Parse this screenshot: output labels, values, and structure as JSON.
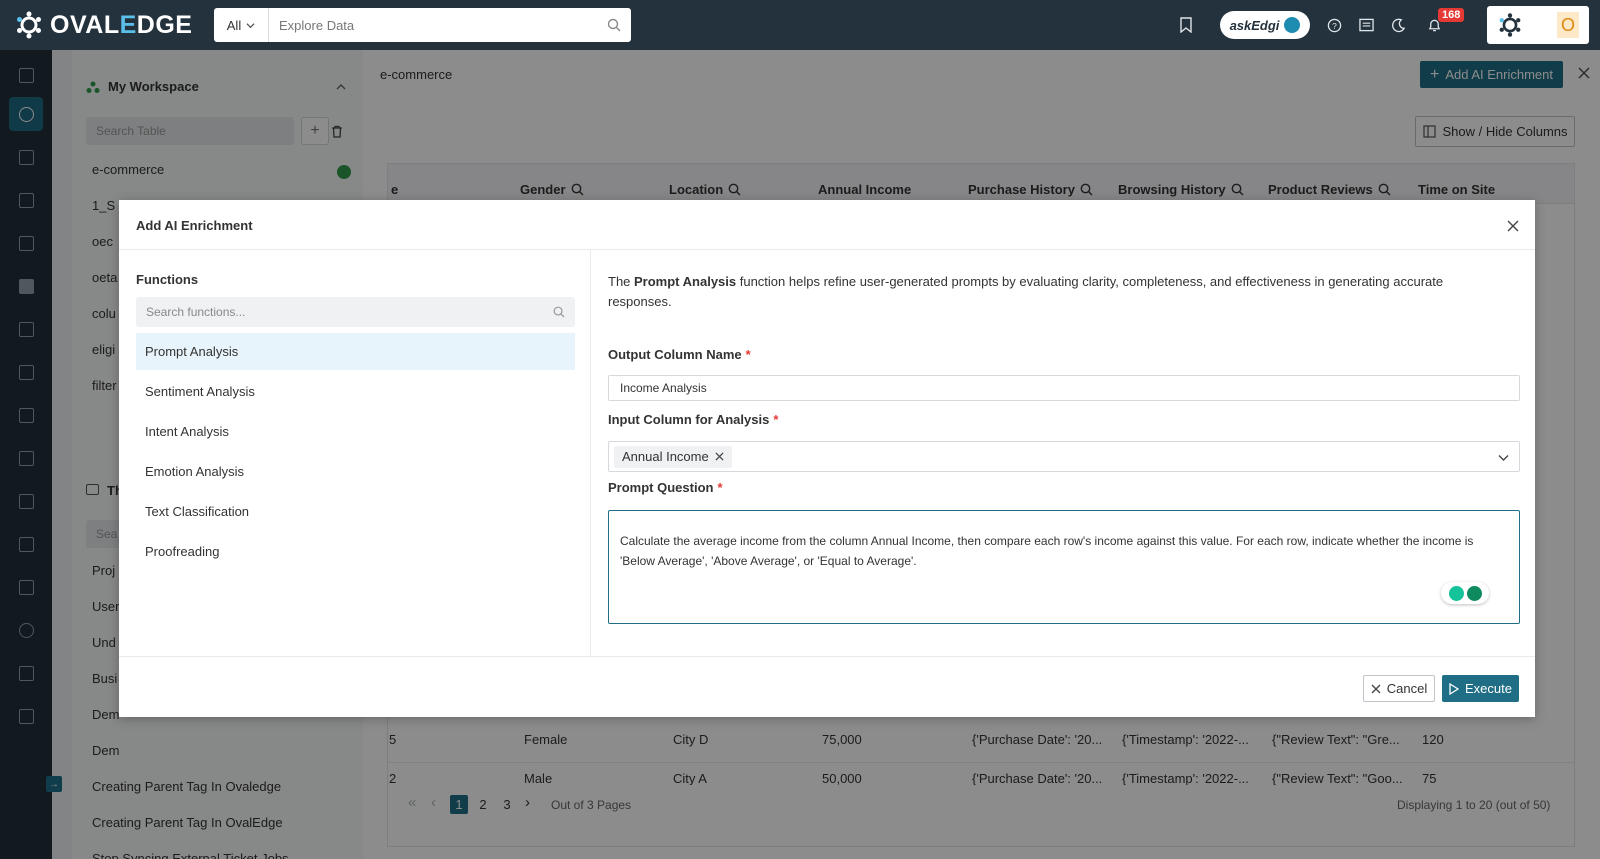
{
  "app": {
    "logo_prefix": "OVAL",
    "logo_highlight": "E",
    "logo_suffix": "DGE"
  },
  "topbar": {
    "search_scope": "All",
    "search_placeholder": "Explore Data",
    "askedgi_label": "askEdgi",
    "notification_count": "168",
    "user_initial": "O"
  },
  "workspace": {
    "title": "My Workspace",
    "search_placeholder": "Search Table",
    "items": [
      "e-commerce",
      "1_S",
      "oec",
      "oeta",
      "colu",
      "eligi",
      "filter"
    ],
    "section_title": "Th",
    "search2_placeholder": "Sea",
    "items2": [
      "Proj",
      "User",
      "Und",
      "Busi",
      "Dem",
      "Dem",
      "Creating Parent Tag In Ovaledge",
      "Creating Parent Tag In OvalEdge",
      "Stop Syncing External Ticket Jobs"
    ]
  },
  "main": {
    "title": "e-commerce",
    "add_enrichment_label": "Add AI Enrichment",
    "show_hide_label": "Show / Hide Columns",
    "columns": [
      "e",
      "Gender",
      "Location",
      "Annual Income",
      "Purchase History",
      "Browsing History",
      "Product Reviews",
      "Time on Site"
    ],
    "rows": [
      {
        "c0": "5",
        "gender": "Female",
        "location": "City D",
        "income": "75,000",
        "purchase": "{'Purchase Date': '20...",
        "browsing": "{'Timestamp': '2022-...",
        "reviews": "{\"Review Text\": \"Gre...",
        "time": "120"
      },
      {
        "c0": "2",
        "gender": "Male",
        "location": "City A",
        "income": "50,000",
        "purchase": "{'Purchase Date': '20...",
        "browsing": "{'Timestamp': '2022-...",
        "reviews": "{\"Review Text\": \"Goo...",
        "time": "75"
      }
    ],
    "pager": {
      "pages": [
        "1",
        "2",
        "3"
      ],
      "out_of": "Out of 3 Pages",
      "displaying": "Displaying 1 to 20 (out of 50)"
    }
  },
  "modal": {
    "title": "Add AI Enrichment",
    "functions_label": "Functions",
    "functions_search_placeholder": "Search functions...",
    "functions": [
      "Prompt Analysis",
      "Sentiment Analysis",
      "Intent Analysis",
      "Emotion Analysis",
      "Text Classification",
      "Proofreading"
    ],
    "selected_function": "Prompt Analysis",
    "description_prefix": "The ",
    "description_bold": "Prompt Analysis",
    "description_suffix": " function helps refine user-generated prompts by evaluating clarity, completeness, and effectiveness in generating accurate responses.",
    "output_label": "Output Column Name",
    "output_value": "Income Analysis",
    "input_label": "Input Column for Analysis",
    "input_chip": "Annual Income",
    "prompt_label": "Prompt Question",
    "prompt_value": "Calculate the average income from the column Annual Income, then compare each row's income against this value. For each row, indicate whether the income is 'Below Average', 'Above Average', or 'Equal to Average'.",
    "required_mark": "*",
    "cancel_label": "Cancel",
    "execute_label": "Execute"
  },
  "colors": {
    "topbar": "#24323d",
    "accent": "#1f6e86",
    "selected_function_bg": "#e8f4fb",
    "required": "#e53935"
  }
}
